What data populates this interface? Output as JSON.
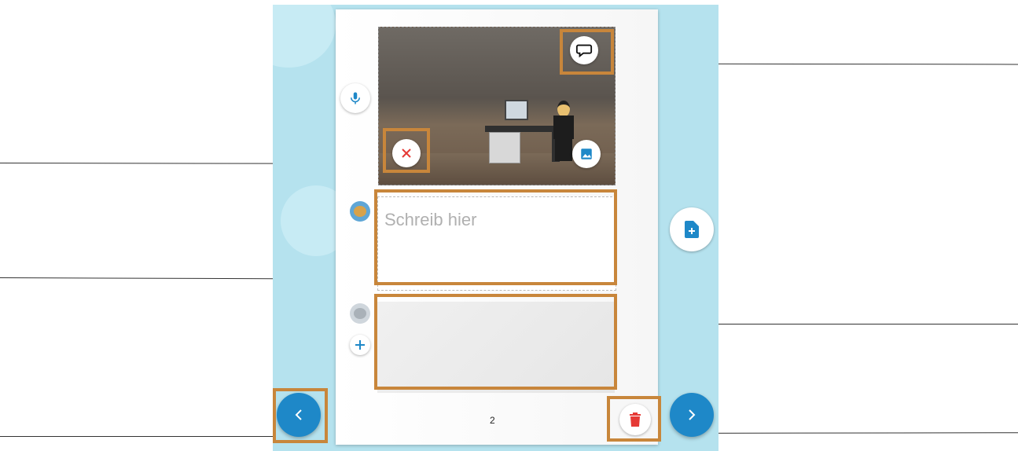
{
  "editor": {
    "text_placeholder": "Schreib hier",
    "page_number": "2"
  },
  "icons": {
    "mic": "microphone-icon",
    "speech": "speech-bubble-icon",
    "remove": "close-icon",
    "image": "image-icon",
    "add_page": "add-file-icon",
    "add": "plus-icon",
    "delete": "trash-icon",
    "prev": "chevron-left-icon",
    "next": "chevron-right-icon"
  },
  "colors": {
    "accent": "#1e88c8",
    "danger": "#e53935",
    "highlight": "#c8863b",
    "background": "#b5e2ee"
  }
}
